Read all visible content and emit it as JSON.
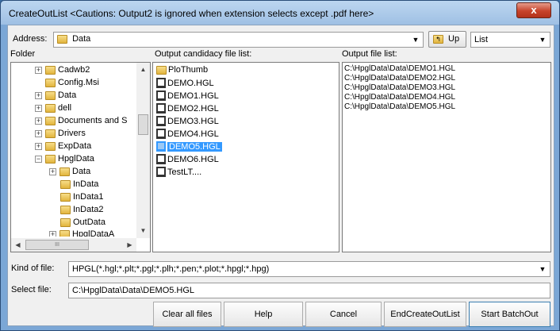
{
  "window": {
    "title": "CreateOutList <Cautions: Output2 is ignored when extension selects except .pdf here>",
    "close_glyph": "x"
  },
  "address": {
    "label": "Address:",
    "value": "Data"
  },
  "up_button": {
    "label": "Up"
  },
  "view_combo": {
    "value": "List"
  },
  "folder_panel": {
    "heading": "Folder",
    "items": [
      {
        "label": "Cadwb2"
      },
      {
        "label": "Config.Msi"
      },
      {
        "label": "Data"
      },
      {
        "label": "dell"
      },
      {
        "label": "Documents and S"
      },
      {
        "label": "Drivers"
      },
      {
        "label": "ExpData"
      },
      {
        "label": "HpglData"
      },
      {
        "label": "Data"
      },
      {
        "label": "InData"
      },
      {
        "label": "InData1"
      },
      {
        "label": "InData2"
      },
      {
        "label": "OutData"
      },
      {
        "label": "HpglDataA"
      }
    ],
    "hscroll_label": "III"
  },
  "candidate_panel": {
    "heading": "Output candidacy file list:",
    "items": [
      {
        "label": "PloThumb"
      },
      {
        "label": "DEMO.HGL"
      },
      {
        "label": "DEMO1.HGL"
      },
      {
        "label": "DEMO2.HGL"
      },
      {
        "label": "DEMO3.HGL"
      },
      {
        "label": "DEMO4.HGL"
      },
      {
        "label": "DEMO5.HGL"
      },
      {
        "label": "DEMO6.HGL"
      },
      {
        "label": "TestLT...."
      }
    ]
  },
  "output_panel": {
    "heading": "Output file list:",
    "items": [
      "C:\\HpglData\\Data\\DEMO1.HGL",
      "C:\\HpglData\\Data\\DEMO2.HGL",
      "C:\\HpglData\\Data\\DEMO3.HGL",
      "C:\\HpglData\\Data\\DEMO4.HGL",
      "C:\\HpglData\\Data\\DEMO5.HGL"
    ]
  },
  "kind_of_file": {
    "label": "Kind of file:",
    "value": "HPGL(*.hgl;*.plt;*.pgl;*.plh;*.pen;*.plot;*.hpgl;*.hpg)"
  },
  "select_file": {
    "label": "Select file:",
    "value": "C:\\HpglData\\Data\\DEMO5.HGL"
  },
  "buttons": {
    "clear": "Clear all files",
    "help": "Help",
    "cancel": "Cancel",
    "end": "EndCreateOutList",
    "start": "Start BatchOut"
  }
}
